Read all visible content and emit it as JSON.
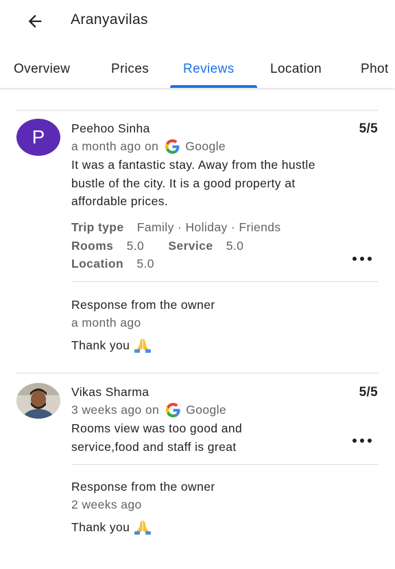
{
  "header": {
    "title": "Aranyavilas",
    "back_icon": "arrow-left-icon"
  },
  "tabs": [
    {
      "label": "Overview"
    },
    {
      "label": "Prices"
    },
    {
      "label": "Reviews"
    },
    {
      "label": "Location"
    },
    {
      "label": "Phot"
    }
  ],
  "active_tab": "Reviews",
  "colors": {
    "accent": "#1a73e8",
    "avatar_bg": "#5b2bb5"
  },
  "reviews": [
    {
      "avatar_letter": "P",
      "name": "Peehoo Sinha",
      "score": "5/5",
      "time": "a month ago on",
      "source": "Google",
      "text": "It was a fantastic stay. Away from the hustle bustle of the city. It is a good property at affordable prices.",
      "attributes": {
        "trip_type_label": "Trip type",
        "trip_type_value": "Family · Holiday · Friends",
        "rooms_label": "Rooms",
        "rooms_value": "5.0",
        "service_label": "Service",
        "service_value": "5.0",
        "location_label": "Location",
        "location_value": "5.0"
      },
      "response": {
        "label": "Response from the owner",
        "time": "a month ago",
        "text": "Thank you"
      }
    },
    {
      "avatar_letter": "",
      "name": "Vikas Sharma",
      "score": "5/5",
      "time": "3 weeks ago on",
      "source": "Google",
      "text": "Rooms view was too good and service,food and staff is great",
      "response": {
        "label": "Response from the owner",
        "time": "2 weeks ago",
        "text": "Thank you"
      }
    }
  ]
}
